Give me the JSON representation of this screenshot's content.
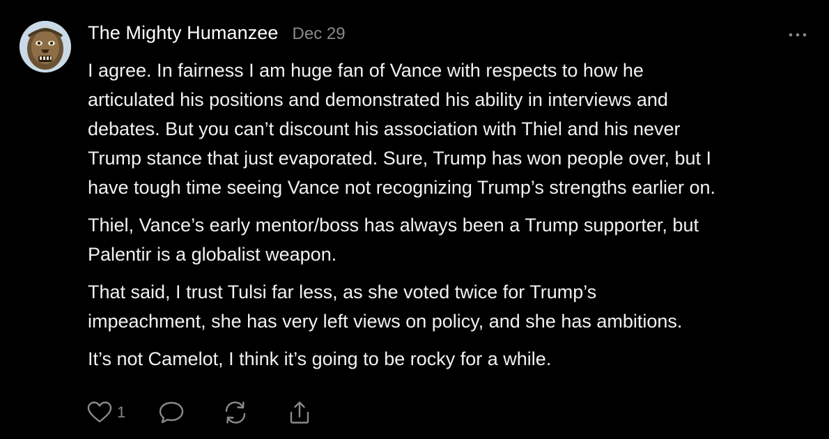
{
  "comment": {
    "author": "The Mighty Humanzee",
    "date": "Dec 29",
    "paragraphs": [
      "I agree. In fairness I am huge fan of Vance with respects to how he\narticulated his positions and demonstrated his ability in interviews and\ndebates. But you can’t discount his association with Thiel and his never\nTrump stance that just evaporated. Sure, Trump has won people over, but I\nhave tough time seeing Vance not recognizing Trump’s strengths earlier on.",
      "Thiel, Vance’s early mentor/boss has always been a Trump supporter, but\nPalentir is a globalist weapon.",
      "That said, I trust Tulsi far less, as she voted twice for Trump’s\nimpeachment, she has very left views on policy, and she has ambitions.",
      "It’s not Camelot, I think it’s going to be rocky for a while."
    ],
    "like_count": "1"
  },
  "icons": {
    "avatar": "avatar-image",
    "more": "more-dots-icon",
    "like": "heart-icon",
    "reply": "comment-bubble-icon",
    "restack": "restack-icon",
    "share": "share-icon"
  },
  "colors": {
    "background": "#000000",
    "text": "#f2f2f2",
    "muted": "#8a8a8e"
  }
}
